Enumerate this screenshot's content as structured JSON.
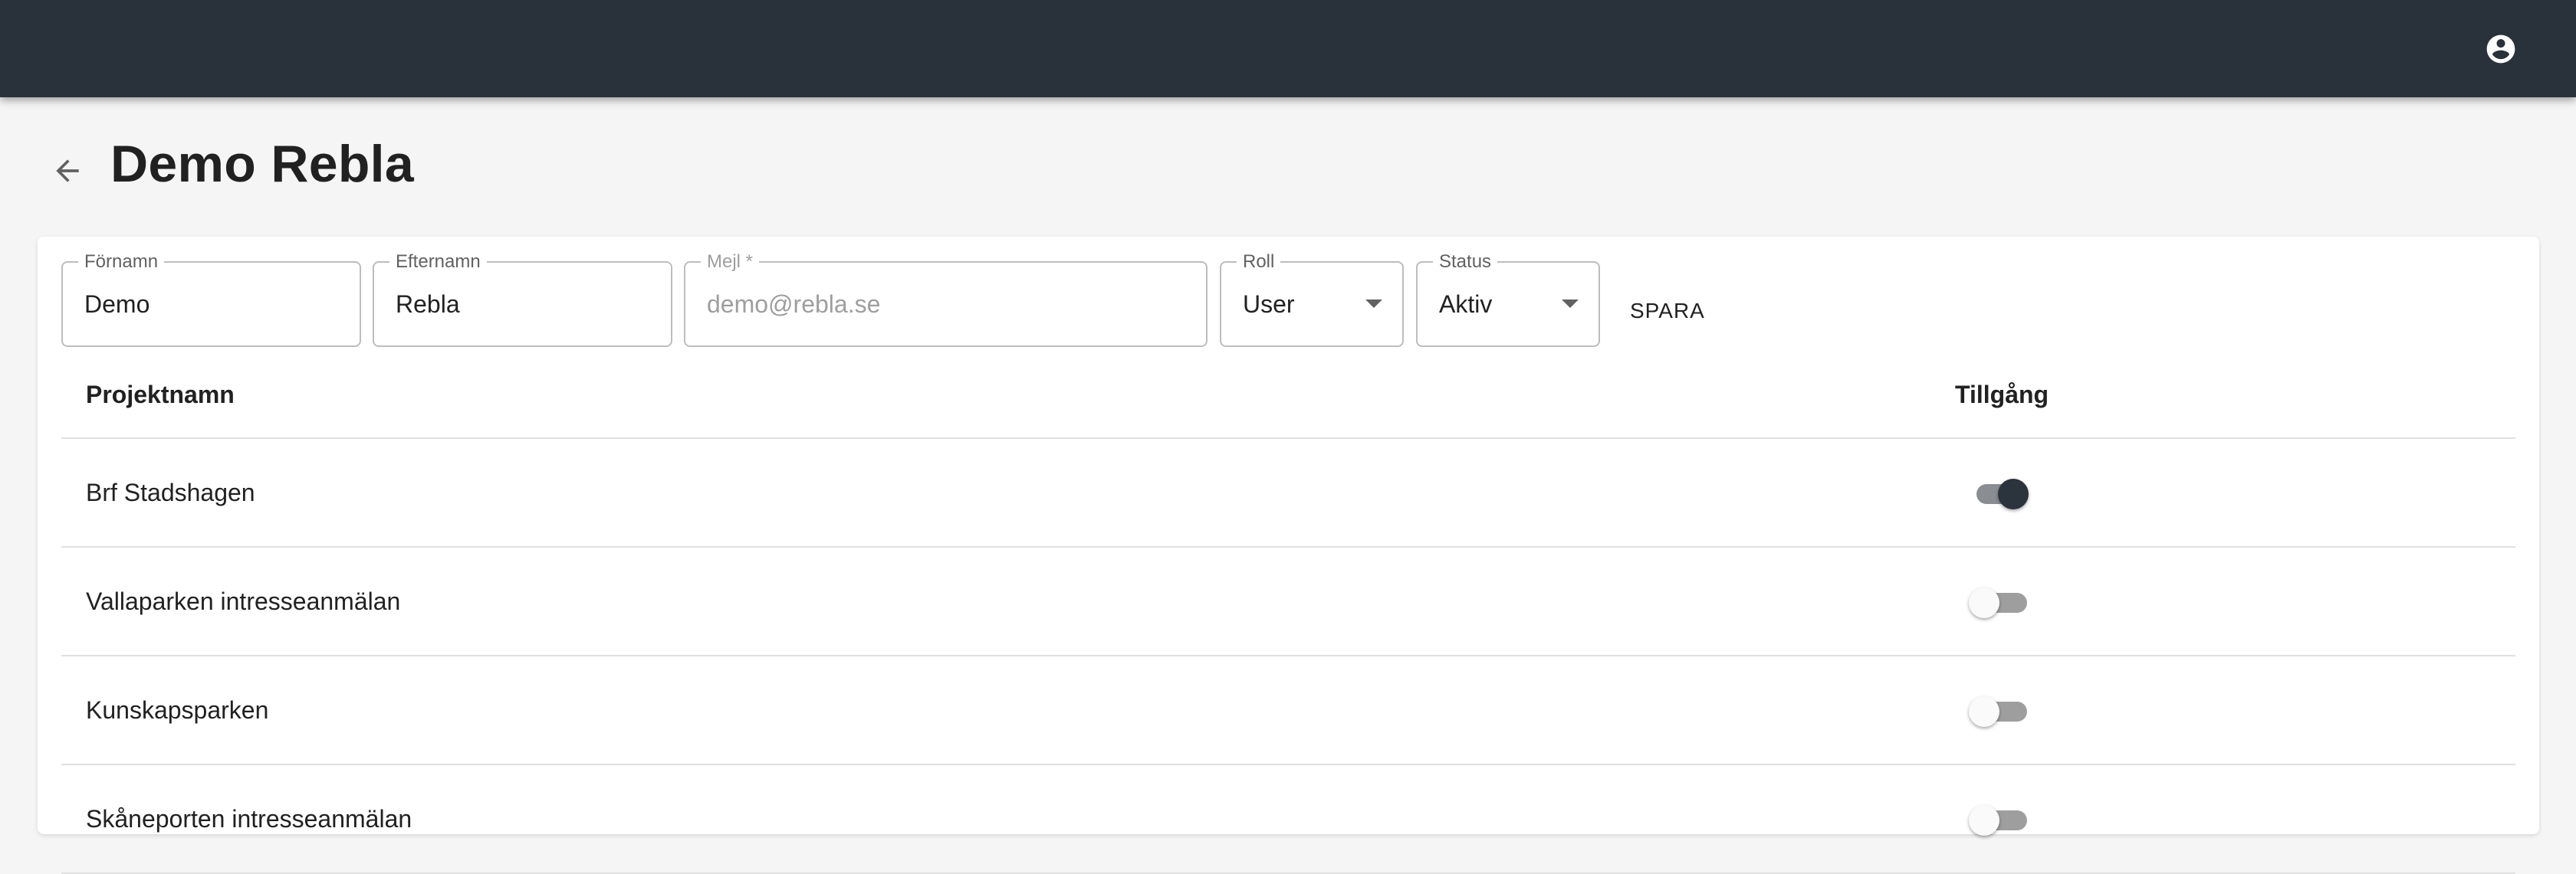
{
  "appbar": {
    "account_icon": "account-circle-icon"
  },
  "header": {
    "back_icon": "arrow-back-icon",
    "title": "Demo Rebla"
  },
  "form": {
    "first_name": {
      "label": "Förnamn",
      "value": "Demo"
    },
    "last_name": {
      "label": "Efternamn",
      "value": "Rebla"
    },
    "email": {
      "label": "Mejl *",
      "placeholder": "demo@rebla.se"
    },
    "role": {
      "label": "Roll",
      "value": "User"
    },
    "status": {
      "label": "Status",
      "value": "Aktiv"
    },
    "save_label": "SPARA"
  },
  "table": {
    "columns": {
      "project": "Projektnamn",
      "access": "Tillgång"
    },
    "rows": [
      {
        "name": "Brf Stadshagen",
        "access": true
      },
      {
        "name": "Vallaparken intresseanmälan",
        "access": false
      },
      {
        "name": "Kunskapsparken",
        "access": false
      },
      {
        "name": "Skåneporten intresseanmälan",
        "access": false
      }
    ]
  },
  "colors": {
    "appbar": "#29313a",
    "switch_on_thumb": "#2b333c",
    "background": "#f5f5f5"
  }
}
